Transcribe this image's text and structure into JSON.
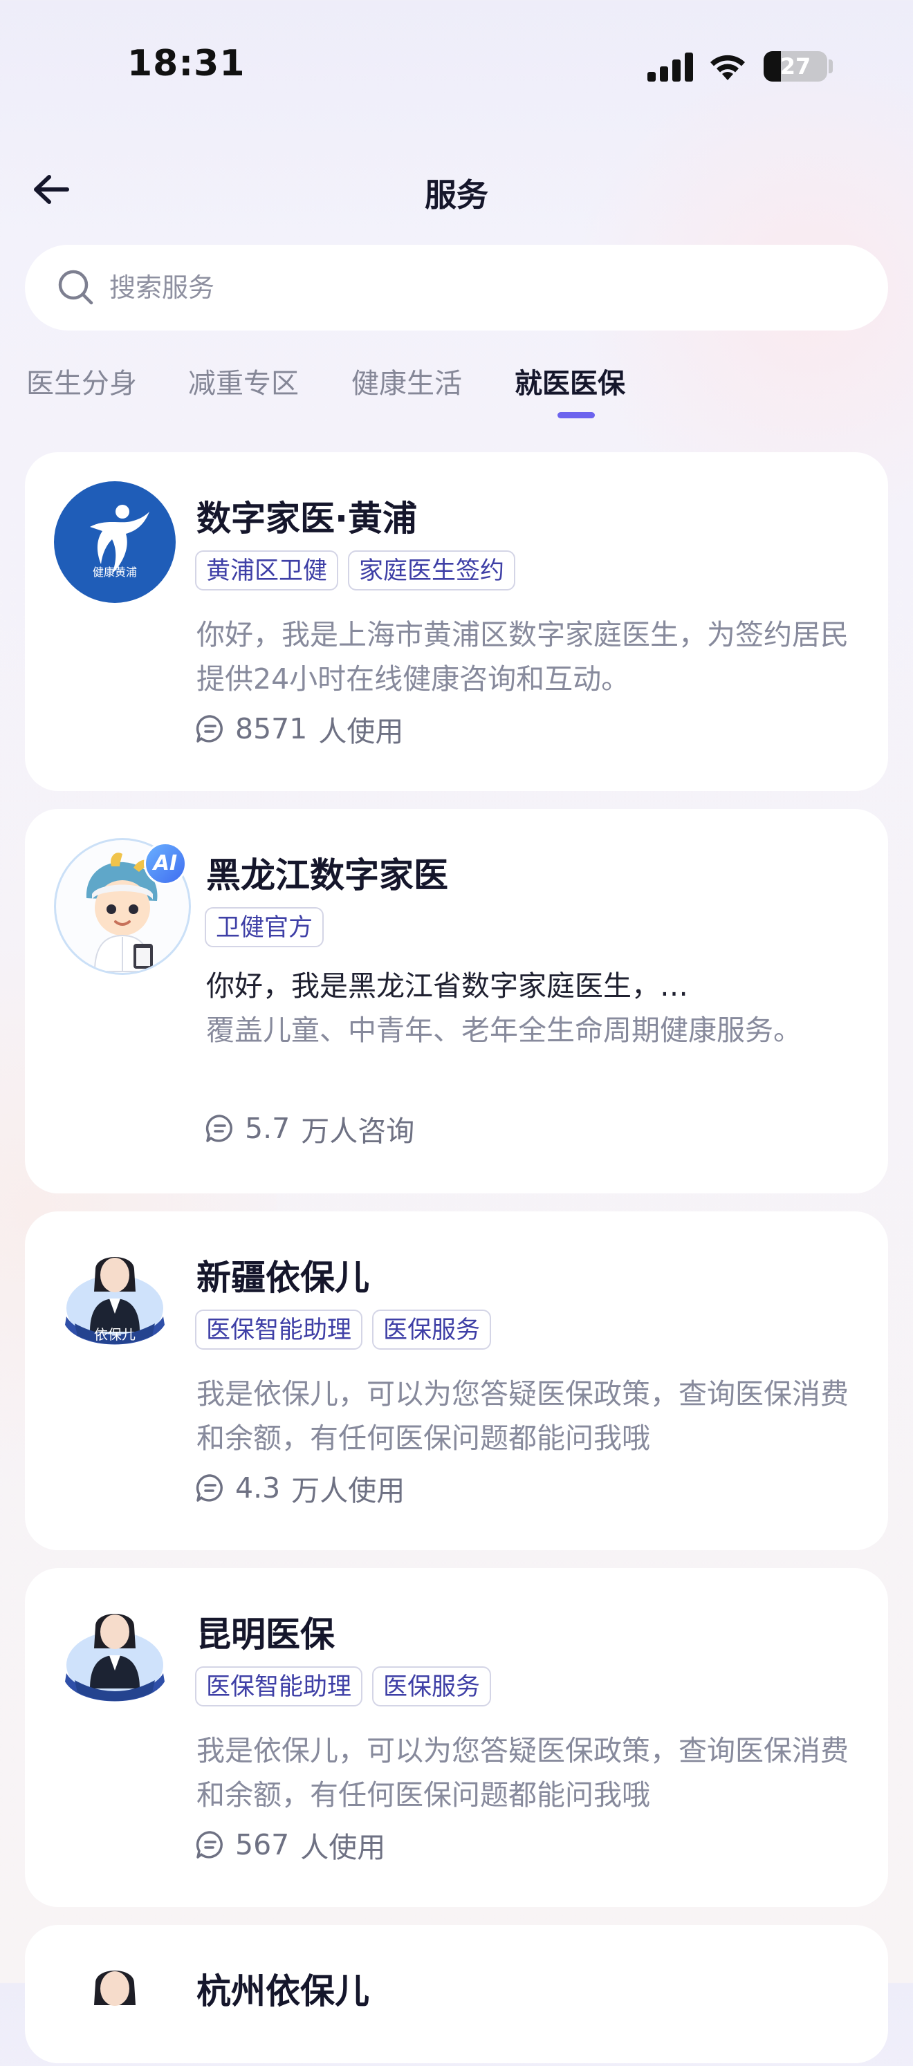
{
  "status_bar": {
    "time": "18:31",
    "battery": "27",
    "battery_level": 0.27
  },
  "header": {
    "title": "服务",
    "back_icon": "arrow-left-icon"
  },
  "search": {
    "placeholder": "搜索服务",
    "value": ""
  },
  "tabs": [
    {
      "label": "医生分身",
      "active": false
    },
    {
      "label": "减重专区",
      "active": false
    },
    {
      "label": "健康生活",
      "active": false
    },
    {
      "label": "就医医保",
      "active": true
    }
  ],
  "cards": [
    {
      "title": "数字家医·黄浦",
      "avatar_text": "健康黄浦",
      "tags": [
        "黄浦区卫健",
        "家庭医生签约"
      ],
      "description": "你好，我是上海市黄浦区数字家庭医生，为签约居民提供24小时在线健康咨询和互动。",
      "usage_count": "8571",
      "usage_label": "人使用"
    },
    {
      "title": "黑龙江数字家医",
      "avatar_badge": "AI",
      "tags": [
        "卫健官方"
      ],
      "greeting": "你好，我是黑龙江省数字家庭医生，…",
      "description": "覆盖儿童、中青年、老年全生命周期健康服务。",
      "usage_count": "5.7",
      "usage_label": "万人咨询"
    },
    {
      "title": "新疆依保儿",
      "avatar_text": "依保儿",
      "tags": [
        "医保智能助理",
        "医保服务"
      ],
      "description": "我是依保儿，可以为您答疑医保政策，查询医保消费和余额，有任何医保问题都能问我哦",
      "usage_count": "4.3",
      "usage_label": "万人使用"
    },
    {
      "title": "昆明医保",
      "tags": [
        "医保智能助理",
        "医保服务"
      ],
      "description": "我是依保儿，可以为您答疑医保政策，查询医保消费和余额，有任何医保问题都能问我哦",
      "usage_count": "567",
      "usage_label": "人使用"
    },
    {
      "title": "杭州依保儿"
    }
  ]
}
